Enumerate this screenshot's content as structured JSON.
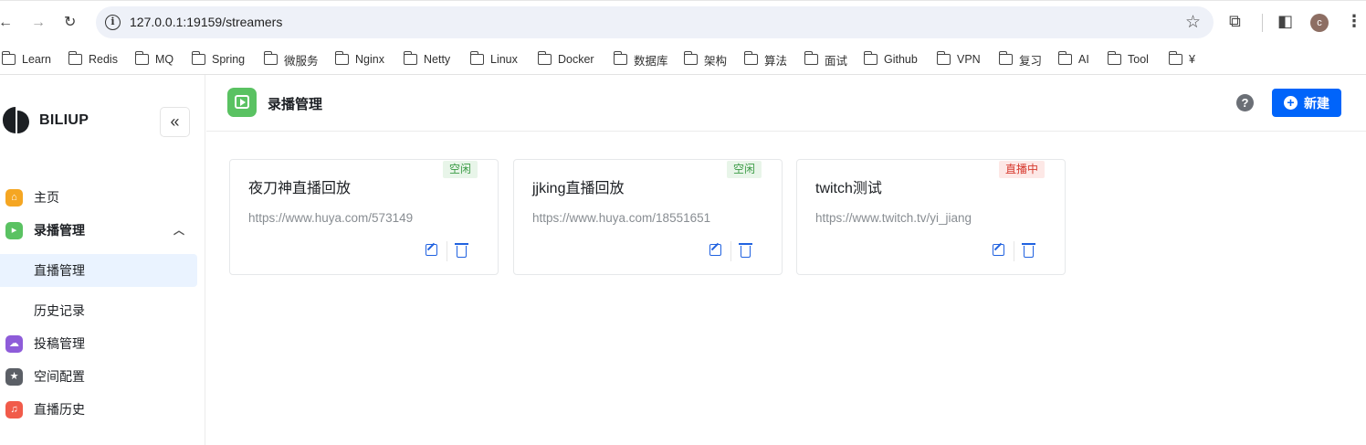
{
  "browser": {
    "url": "127.0.0.1:19159/streamers",
    "avatar_letter": "c"
  },
  "bookmarks": [
    "Learn",
    "Redis",
    "MQ",
    "Spring",
    "微服务",
    "Nginx",
    "Netty",
    "Linux",
    "Docker",
    "数据库",
    "架构",
    "算法",
    "面试",
    "Github",
    "VPN",
    "复习",
    "AI",
    "Tool",
    "¥"
  ],
  "sidebar": {
    "brand": "BILIUP",
    "items": [
      {
        "label": "主页",
        "icon": "home-icon",
        "color": "#f5a623"
      },
      {
        "label": "录播管理",
        "icon": "video-icon",
        "color": "#5ac262"
      },
      {
        "label": "直播管理"
      },
      {
        "label": "历史记录"
      },
      {
        "label": "投稿管理",
        "icon": "cloud-icon",
        "color": "#8e5cd9"
      },
      {
        "label": "空间配置",
        "icon": "star-icon",
        "color": "#5b5f66"
      },
      {
        "label": "直播历史",
        "icon": "headset-icon",
        "color": "#f15b4a"
      }
    ]
  },
  "header": {
    "title": "录播管理",
    "new_label": "新建"
  },
  "cards": [
    {
      "name": "夜刀神直播回放",
      "url": "https://www.huya.com/573149",
      "status": "空闲",
      "status_type": "idle"
    },
    {
      "name": "jjking直播回放",
      "url": "https://www.huya.com/18551651",
      "status": "空闲",
      "status_type": "idle"
    },
    {
      "name": "twitch测试",
      "url": "https://www.twitch.tv/yi_jiang",
      "status": "直播中",
      "status_type": "live"
    }
  ],
  "colors": {
    "primary": "#0064fa",
    "idle": "#3b9b46",
    "live": "#d63a2f"
  }
}
